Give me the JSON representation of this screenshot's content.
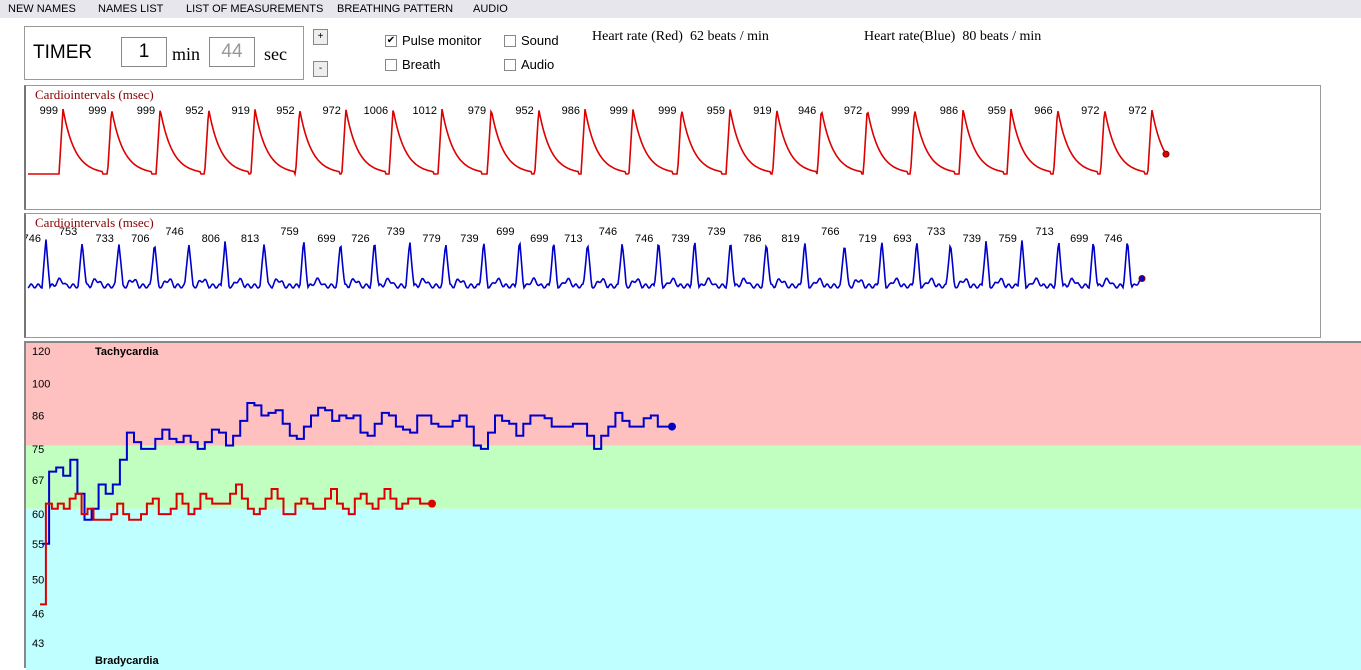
{
  "menu": [
    "NEW NAMES",
    "NAMES LIST",
    "LIST OF MEASUREMENTS",
    "BREATHING PATTERN",
    "AUDIO"
  ],
  "timer": {
    "label": "TIMER",
    "minutes": "1",
    "min_unit": "min",
    "seconds": "44",
    "sec_unit": "sec",
    "plus": "+",
    "minus": "-"
  },
  "options": {
    "pulse_monitor": {
      "label": "Pulse monitor",
      "checked": true
    },
    "sound": {
      "label": "Sound",
      "checked": false
    },
    "breath": {
      "label": "Breath",
      "checked": false
    },
    "audio": {
      "label": "Audio",
      "checked": false
    }
  },
  "heart_rate": {
    "red": "Heart rate (Red)  62 beats / min",
    "blue": "Heart rate(Blue)  80 beats / min"
  },
  "colors": {
    "red": "#dd0000",
    "blue": "#0000cc",
    "tachy": "#ffc0c0",
    "normal": "#c0ffc0",
    "brady": "#c0ffff"
  },
  "chart_data": [
    {
      "type": "line",
      "title": "Cardiointervals (msec)",
      "series": [
        {
          "color": "red",
          "intervals": [
            999,
            999,
            999,
            952,
            919,
            952,
            972,
            1006,
            1012,
            979,
            952,
            986,
            999,
            999,
            959,
            919,
            946,
            972,
            999,
            986,
            959,
            966,
            972,
            972
          ]
        }
      ]
    },
    {
      "type": "line",
      "title": "Cardiointervals (msec)",
      "series": [
        {
          "color": "blue",
          "intervals": [
            746,
            753,
            733,
            706,
            746,
            806,
            813,
            759,
            699,
            726,
            739,
            779,
            739,
            699,
            699,
            713,
            746,
            746,
            739,
            739,
            786,
            819,
            766,
            719,
            693,
            733,
            739,
            759,
            713,
            699,
            746
          ]
        }
      ]
    },
    {
      "type": "line",
      "y_scale": "reciprocal",
      "yticks": [
        120,
        100,
        86,
        75,
        67,
        60,
        55,
        50,
        46,
        43
      ],
      "ylim": [
        43,
        120
      ],
      "zones": [
        {
          "label": "Tachycardia",
          "from": 76,
          "to": 120
        },
        {
          "label": "",
          "from": 61,
          "to": 76
        },
        {
          "label": "Bradycardia",
          "from": 43,
          "to": 61
        }
      ],
      "series": [
        {
          "color": "blue",
          "values": [
            55,
            69,
            70,
            68,
            72,
            64,
            59,
            61,
            66,
            64,
            66,
            72,
            80,
            77,
            75,
            75,
            78,
            81,
            78,
            77,
            79,
            77,
            75,
            77,
            81,
            80,
            76,
            79,
            84,
            91,
            90,
            86,
            87,
            88,
            83,
            79,
            78,
            82,
            86,
            89,
            88,
            84,
            86,
            85,
            86,
            80,
            79,
            83,
            87,
            86,
            82,
            81,
            80,
            86,
            86,
            83,
            82,
            82,
            84,
            86,
            82,
            76,
            75,
            80,
            86,
            84,
            83,
            79,
            83,
            86,
            86,
            85,
            82,
            82,
            82,
            83,
            83,
            79,
            75,
            79,
            82,
            87,
            84,
            82,
            82,
            85,
            86,
            82,
            82
          ]
        },
        {
          "color": "red",
          "values": [
            47,
            62,
            61,
            62,
            61,
            63,
            64,
            60,
            61,
            59,
            59,
            59,
            60,
            62,
            60,
            59,
            59,
            60,
            62,
            63,
            60,
            60,
            61,
            64,
            62,
            60,
            61,
            64,
            63,
            62,
            62,
            62,
            64,
            66,
            63,
            61,
            60,
            61,
            63,
            65,
            63,
            60,
            60,
            62,
            63,
            62,
            61,
            61,
            63,
            65,
            62,
            61,
            60,
            63,
            64,
            62,
            61,
            63,
            65,
            63,
            61,
            62,
            63,
            63,
            62,
            62
          ]
        }
      ]
    }
  ]
}
